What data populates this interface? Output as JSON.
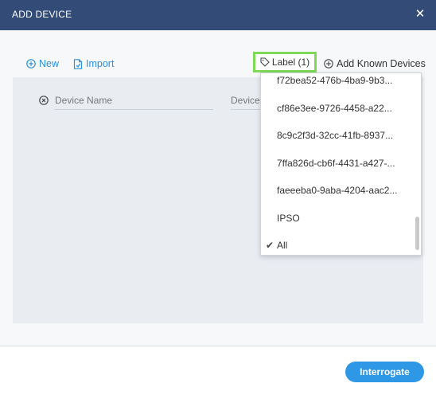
{
  "window": {
    "title": "ADD DEVICE",
    "close_glyph": "✕"
  },
  "toolbar": {
    "new_label": "New",
    "import_label": "Import",
    "label_button": "Label (1)",
    "add_known_label": "Add Known Devices"
  },
  "form": {
    "device_name_placeholder": "Device Name",
    "device_second_placeholder": "Device"
  },
  "label_dropdown": {
    "items": [
      {
        "text": "f72bea52-476b-4ba9-9b3...",
        "checked": false
      },
      {
        "text": "cf86e3ee-9726-4458-a22...",
        "checked": false
      },
      {
        "text": "8c9c2f3d-32cc-41fb-8937...",
        "checked": false
      },
      {
        "text": "7ffa826d-cb6f-4431-a427-...",
        "checked": false
      },
      {
        "text": "faeeeba0-9aba-4204-aac2...",
        "checked": false
      },
      {
        "text": "IPSO",
        "checked": false
      },
      {
        "text": "All",
        "checked": true
      }
    ]
  },
  "footer": {
    "primary_label": "Interrogate"
  },
  "colors": {
    "titlebar": "#334c77",
    "accent": "#2e98e6",
    "highlight": "#7ed957"
  }
}
